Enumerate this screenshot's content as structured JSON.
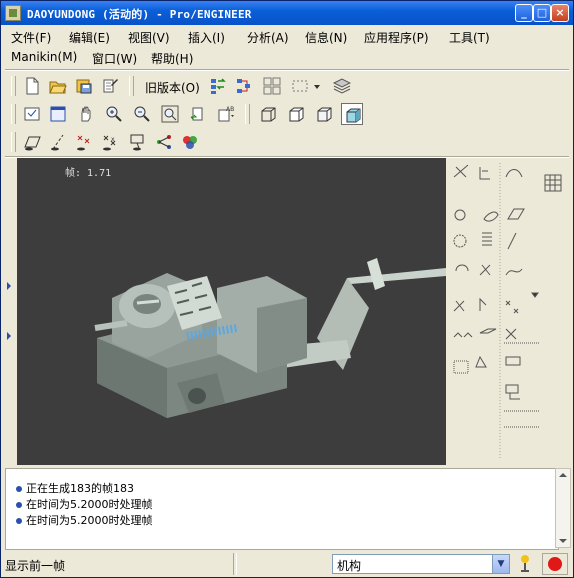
{
  "window": {
    "title": "DAOYUNDONG (活动的) - Pro/ENGINEER",
    "controls": {
      "minimize": "_",
      "maximize": "□",
      "close": "×"
    }
  },
  "menu": {
    "row1": [
      "文件(F)",
      "编辑(E)",
      "视图(V)",
      "插入(I)",
      "分析(A)",
      "信息(N)",
      "应用程序(P)",
      "工具(T)"
    ],
    "row2": [
      "Manikin(M)",
      "窗口(W)",
      "帮助(H)"
    ]
  },
  "toolbar": {
    "old_version_label": "旧版本(O)",
    "icons_row1": [
      "new-file-icon",
      "open-file-icon",
      "save-icon",
      "print-icon",
      "regenerate-icon",
      "model-tree-icon",
      "layers-icon",
      "selection-filter-icon",
      "dropdown-icon",
      "stack-layers-icon"
    ],
    "icons_row2": [
      "redraw-icon",
      "window-icon",
      "pan-hand-icon",
      "zoom-in-icon",
      "zoom-out-icon",
      "refit-icon",
      "orient-icon",
      "saved-views-icon",
      "wireframe-icon",
      "hidden-line-icon",
      "no-hidden-icon",
      "shading-icon"
    ],
    "icons_row3": [
      "datum-plane-icon",
      "datum-axis-icon",
      "datum-point-icon",
      "csys-icon",
      "spin-center-icon",
      "annotation-icon",
      "color-icon"
    ]
  },
  "viewport": {
    "frame_label": "帧: 1.71",
    "background": "#3d3d3d"
  },
  "messages": [
    "正在生成183的帧183",
    "在时间为5.2000时处理帧",
    "在时间为5.2000时处理帧"
  ],
  "status": {
    "text": "显示前一帧",
    "mode_selected": "机构"
  },
  "colors": {
    "title_bar": "#0852c9",
    "window_bg": "#ece9d8",
    "stop_button": "#e01818"
  }
}
